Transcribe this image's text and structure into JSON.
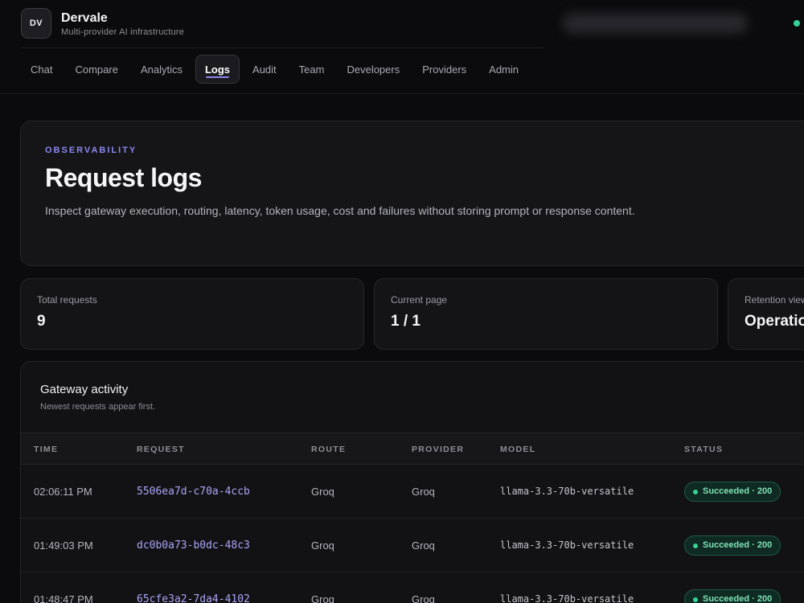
{
  "app": {
    "logo_text": "DV",
    "name": "Dervale",
    "tagline": "Multi-provider AI infrastructure"
  },
  "nav": {
    "tabs": [
      {
        "label": "Chat",
        "active": false
      },
      {
        "label": "Compare",
        "active": false
      },
      {
        "label": "Analytics",
        "active": false
      },
      {
        "label": "Logs",
        "active": true
      },
      {
        "label": "Audit",
        "active": false
      },
      {
        "label": "Team",
        "active": false
      },
      {
        "label": "Developers",
        "active": false
      },
      {
        "label": "Providers",
        "active": false
      },
      {
        "label": "Admin",
        "active": false
      }
    ]
  },
  "hero": {
    "eyebrow": "OBSERVABILITY",
    "title": "Request logs",
    "description": "Inspect gateway execution, routing, latency, token usage, cost and failures without storing prompt or response content."
  },
  "stats": [
    {
      "label": "Total requests",
      "value": "9"
    },
    {
      "label": "Current page",
      "value": "1 / 1"
    },
    {
      "label": "Retention view",
      "value": "Operational"
    }
  ],
  "activity": {
    "title": "Gateway activity",
    "subtitle": "Newest requests appear first.",
    "columns": {
      "time": "TIME",
      "request": "REQUEST",
      "route": "ROUTE",
      "provider": "PROVIDER",
      "model": "MODEL",
      "status": "STATUS"
    },
    "rows": [
      {
        "time": "02:06:11 PM",
        "request": "5506ea7d-c70a-4ccb",
        "route": "Groq",
        "provider": "Groq",
        "model": "llama-3.3-70b-versatile",
        "status": "Succeeded · 200"
      },
      {
        "time": "01:49:03 PM",
        "request": "dc0b0a73-b0dc-48c3",
        "route": "Groq",
        "provider": "Groq",
        "model": "llama-3.3-70b-versatile",
        "status": "Succeeded · 200"
      },
      {
        "time": "01:48:47 PM",
        "request": "65cfe3a2-7da4-4102",
        "route": "Groq",
        "provider": "Groq",
        "model": "llama-3.3-70b-versatile",
        "status": "Succeeded · 200"
      }
    ]
  },
  "colors": {
    "accent": "#8b87f0",
    "success": "#34d399",
    "background": "#0b0b0d"
  }
}
